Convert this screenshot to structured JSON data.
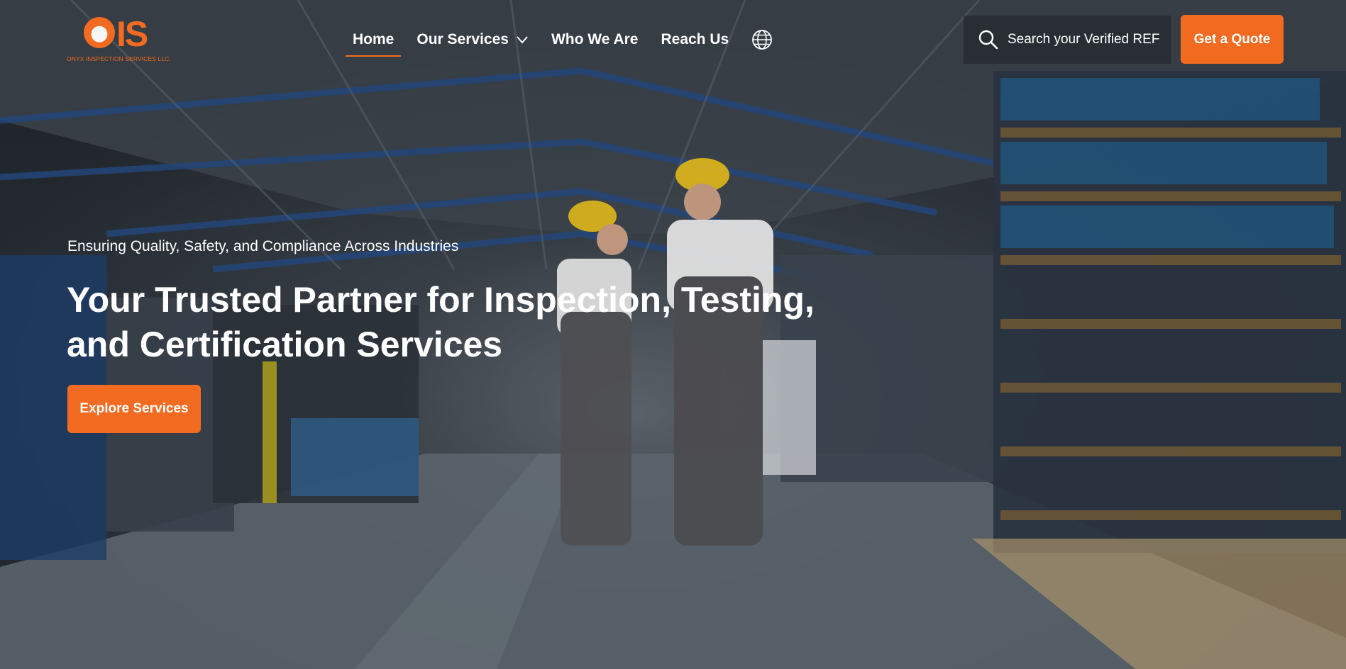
{
  "brand": {
    "logo_mark": "IS",
    "logo_subtitle": "ONYX INSPECTION SERVICES LLC.",
    "accent_color": "#f26b21"
  },
  "nav": {
    "items": [
      {
        "label": "Home",
        "active": true
      },
      {
        "label": "Our Services",
        "has_dropdown": true
      },
      {
        "label": "Who We Are"
      },
      {
        "label": "Reach Us"
      }
    ],
    "language_icon": "globe-icon"
  },
  "search": {
    "label": "Search your Verified REF",
    "icon": "search-icon"
  },
  "header_cta": {
    "label": "Get a Quote"
  },
  "hero": {
    "tagline": "Ensuring Quality, Safety, and Compliance Across Industries",
    "headline_line1": "Your Trusted Partner for Inspection, Testing,",
    "headline_line2": "and Certification Services",
    "cta_label": "Explore Services"
  }
}
